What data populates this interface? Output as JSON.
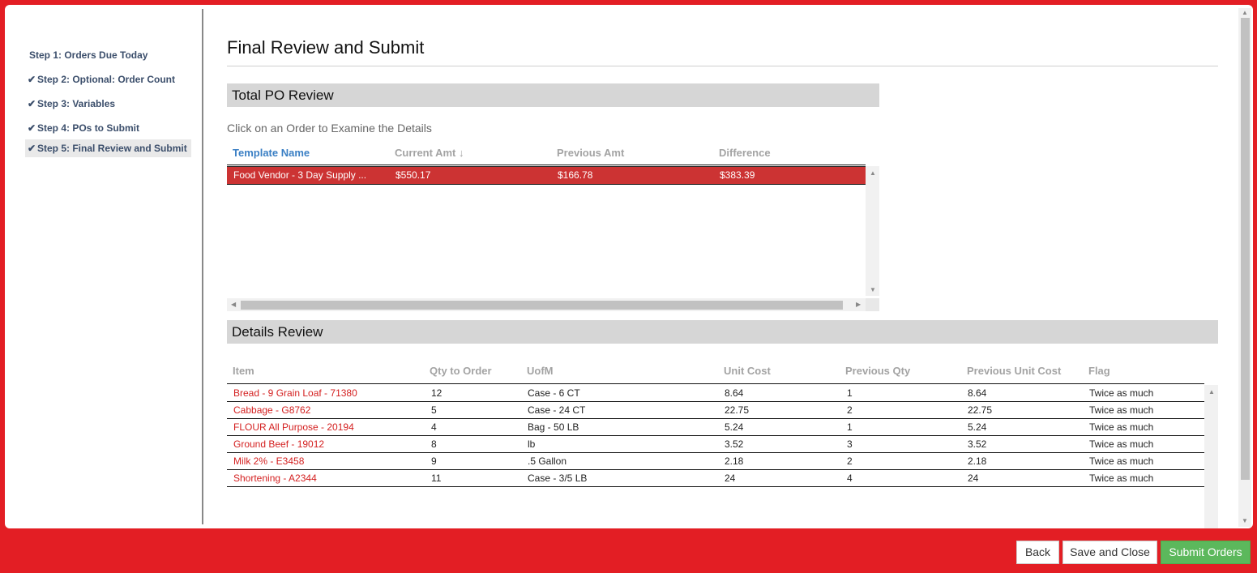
{
  "sidebar": {
    "steps": [
      {
        "label": "Step 1: Orders Due Today",
        "checked": false
      },
      {
        "label": "Step 2: Optional: Order Count",
        "checked": true
      },
      {
        "label": "Step 3: Variables",
        "checked": true
      },
      {
        "label": "Step 4: POs to Submit",
        "checked": true
      },
      {
        "label": "Step 5: Final Review and Submit",
        "checked": true
      }
    ],
    "check_glyph": "✔"
  },
  "main": {
    "title": "Final Review and Submit",
    "po_section": {
      "title": "Total PO Review",
      "hint": "Click on an Order to Examine the Details",
      "columns": [
        "Template Name",
        "Current Amt",
        "Previous Amt",
        "Difference"
      ],
      "sort_arrow": "↓",
      "rows": [
        {
          "template": "Food Vendor - 3 Day Supply ...",
          "current": "$550.17",
          "previous": "$166.78",
          "difference": "$383.39"
        }
      ]
    },
    "details_section": {
      "title": "Details Review",
      "columns": [
        "Item",
        "Qty to Order",
        "UofM",
        "Unit Cost",
        "Previous Qty",
        "Previous Unit Cost",
        "Flag"
      ],
      "rows": [
        {
          "item": "Bread - 9 Grain Loaf - 71380",
          "qty": "12",
          "uofm": "Case - 6 CT",
          "unit_cost": "8.64",
          "prev_qty": "1",
          "prev_cost": "8.64",
          "flag": "Twice as much"
        },
        {
          "item": "Cabbage - G8762",
          "qty": "5",
          "uofm": "Case - 24 CT",
          "unit_cost": "22.75",
          "prev_qty": "2",
          "prev_cost": "22.75",
          "flag": "Twice as much"
        },
        {
          "item": "FLOUR All Purpose - 20194",
          "qty": "4",
          "uofm": "Bag - 50 LB",
          "unit_cost": "5.24",
          "prev_qty": "1",
          "prev_cost": "5.24",
          "flag": "Twice as much"
        },
        {
          "item": "Ground Beef - 19012",
          "qty": "8",
          "uofm": "lb",
          "unit_cost": "3.52",
          "prev_qty": "3",
          "prev_cost": "3.52",
          "flag": "Twice as much"
        },
        {
          "item": "Milk 2% - E3458",
          "qty": "9",
          "uofm": ".5 Gallon",
          "unit_cost": "2.18",
          "prev_qty": "2",
          "prev_cost": "2.18",
          "flag": "Twice as much"
        },
        {
          "item": "Shortening - A2344",
          "qty": "11",
          "uofm": "Case - 3/5 LB",
          "unit_cost": "24",
          "prev_qty": "4",
          "prev_cost": "24",
          "flag": "Twice as much"
        }
      ]
    }
  },
  "footer": {
    "back_label": "Back",
    "save_label": "Save and Close",
    "submit_label": "Submit Orders"
  },
  "colors": {
    "frame": "#e31e24",
    "selected_row": "#cc3333",
    "link": "#3a7fc4",
    "item_text": "#d42020",
    "submit": "#5cb85c"
  }
}
